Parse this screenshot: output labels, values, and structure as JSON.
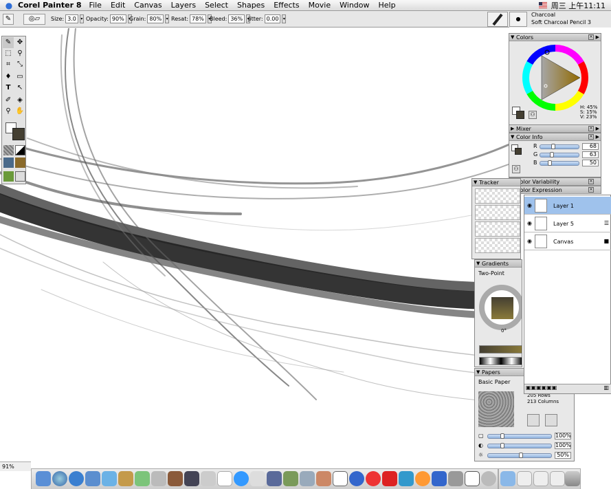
{
  "menubar": {
    "app_name": "Corel Painter 8",
    "menus": [
      "File",
      "Edit",
      "Canvas",
      "Layers",
      "Select",
      "Shapes",
      "Effects",
      "Movie",
      "Window",
      "Help"
    ],
    "clock": "周三 上午11:11"
  },
  "property_bar": {
    "size_label": "Size:",
    "size_value": "3.0",
    "opacity_label": "Opacity:",
    "opacity_value": "90%",
    "grain_label": "Grain:",
    "grain_value": "80%",
    "resat_label": "Resat:",
    "resat_value": "78%",
    "bleed_label": "Bleed:",
    "bleed_value": "36%",
    "jitter_label": "Jitter:",
    "jitter_value": "0.00"
  },
  "brush_selector": {
    "category": "Charcoal",
    "variant": "Soft Charcoal Pencil 3"
  },
  "colors_panel": {
    "title": "Colors",
    "h": "H: 45%",
    "s": "S: 15%",
    "v": "V: 23%"
  },
  "mixer_panel": {
    "title": "Mixer"
  },
  "color_info_panel": {
    "title": "Color Info",
    "r_label": "R",
    "r_value": "68",
    "g_label": "G",
    "g_value": "63",
    "b_label": "B",
    "b_value": "50"
  },
  "color_variability_panel": {
    "title": "Color Variability"
  },
  "color_expression_panel": {
    "title": "Color Expression"
  },
  "tracker_panel": {
    "title": "Tracker"
  },
  "gradients_panel": {
    "title": "Gradients",
    "type": "Two-Point",
    "angle": "0°"
  },
  "papers_panel": {
    "title": "Papers",
    "paper_name": "Basic Paper",
    "rows": "205 Rows",
    "columns": "213 Columns",
    "scale_value": "100%",
    "contrast_value": "100%",
    "brightness_value": "50%"
  },
  "layers_panel": {
    "layers": [
      "Layer 1",
      "Layer 5",
      "Canvas"
    ]
  },
  "statusbar": {
    "zoom": "91%"
  },
  "colors": {
    "main_color": "#443f32",
    "selection_blue": "#9fc2ec",
    "color_info_r": 68,
    "color_info_g": 63,
    "color_info_b": 50
  }
}
